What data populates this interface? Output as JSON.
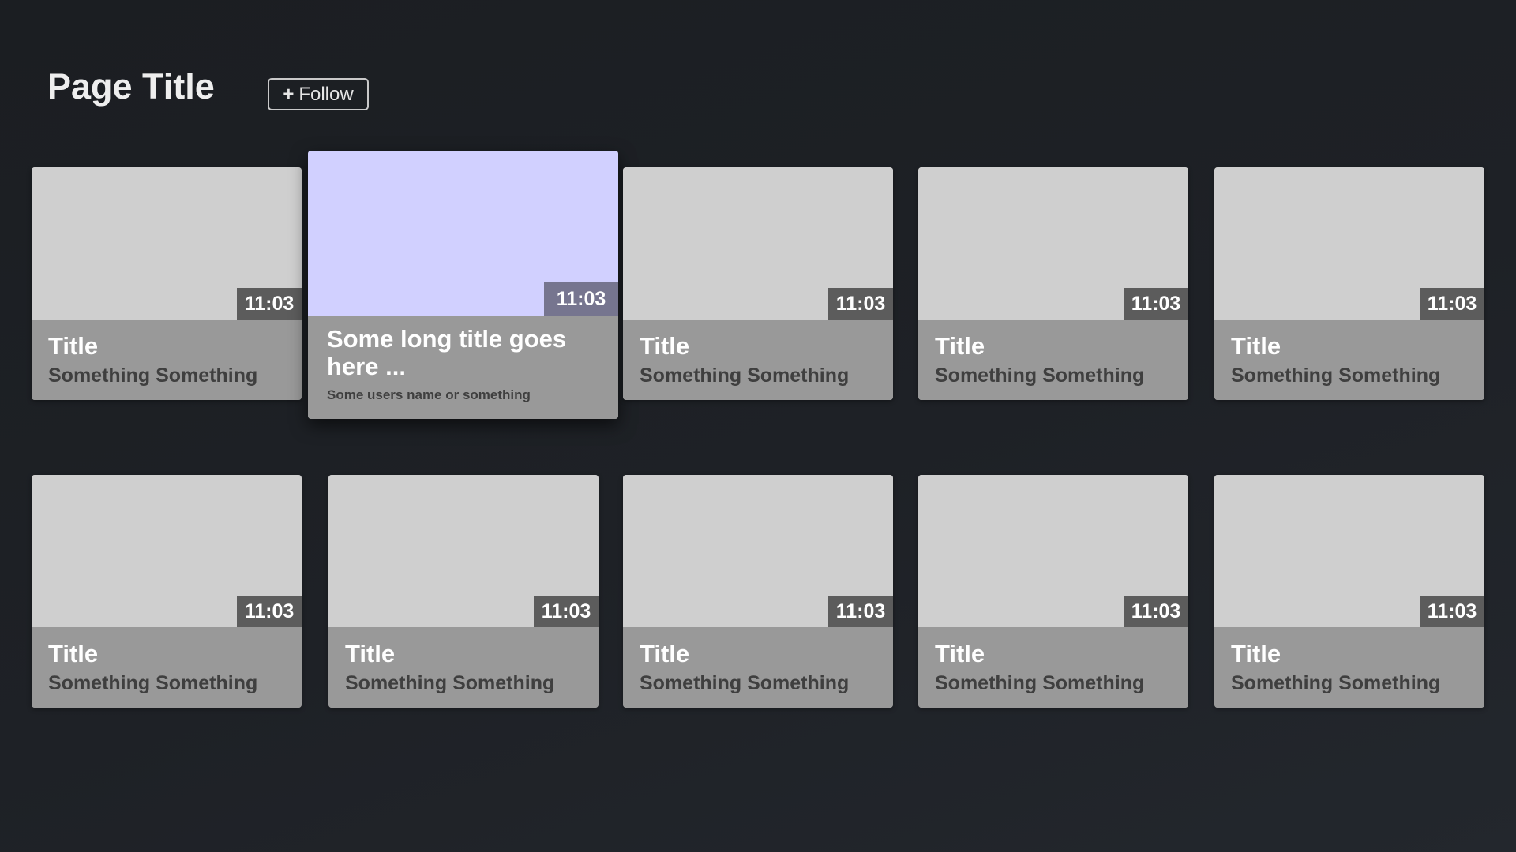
{
  "header": {
    "title": "Page Title",
    "follow_label": "Follow",
    "follow_icon": "+"
  },
  "colors": {
    "background": "#1e2126",
    "card_thumb": "#cfcfcf",
    "card_info": "#999999",
    "focused_thumb": "#d1d0ff",
    "duration_badge": "#5c5c5c",
    "focused_duration_badge": "#76758f"
  },
  "rows": [
    {
      "cards": [
        {
          "duration": "11:03",
          "title": "Title",
          "subtitle": "Something Something",
          "focused": false
        },
        {
          "duration": "11:03",
          "title": "Some long title goes here ...",
          "subtitle": "Some users name or something",
          "focused": true
        },
        {
          "duration": "11:03",
          "title": "Title",
          "subtitle": "Something Something",
          "focused": false
        },
        {
          "duration": "11:03",
          "title": "Title",
          "subtitle": "Something Something",
          "focused": false
        },
        {
          "duration": "11:03",
          "title": "Title",
          "subtitle": "Something Something",
          "focused": false
        }
      ]
    },
    {
      "cards": [
        {
          "duration": "11:03",
          "title": "Title",
          "subtitle": "Something Something",
          "focused": false
        },
        {
          "duration": "11:03",
          "title": "Title",
          "subtitle": "Something Something",
          "focused": false
        },
        {
          "duration": "11:03",
          "title": "Title",
          "subtitle": "Something Something",
          "focused": false
        },
        {
          "duration": "11:03",
          "title": "Title",
          "subtitle": "Something Something",
          "focused": false
        },
        {
          "duration": "11:03",
          "title": "Title",
          "subtitle": "Something Something",
          "focused": false
        }
      ]
    }
  ]
}
